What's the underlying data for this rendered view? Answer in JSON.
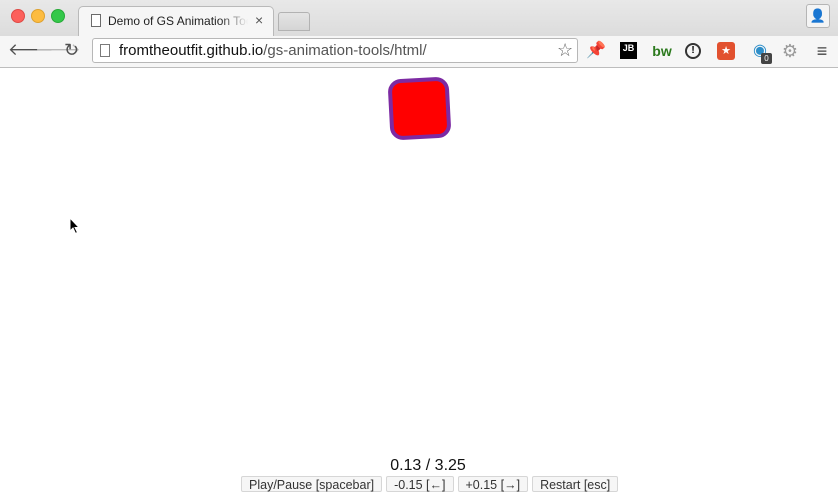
{
  "browser": {
    "tab_title": "Demo of GS Animation Tools",
    "tab_close": "×",
    "url_host": "fromtheoutfit.github.io",
    "url_path": "/gs-animation-tools/html/",
    "extensions": {
      "jb_label": "JB",
      "bw_label": "bw",
      "badge_count": "0"
    }
  },
  "page": {
    "time_display": "0.13 / 3.25",
    "controls": [
      {
        "label": "Play/Pause [spacebar]"
      },
      {
        "label": "-0.15 [←]"
      },
      {
        "label": "+0.15 [→]"
      },
      {
        "label": "Restart [esc]"
      }
    ],
    "animated_box": {
      "fill_color": "#ff0000",
      "border_color": "#7d2aa3"
    }
  }
}
